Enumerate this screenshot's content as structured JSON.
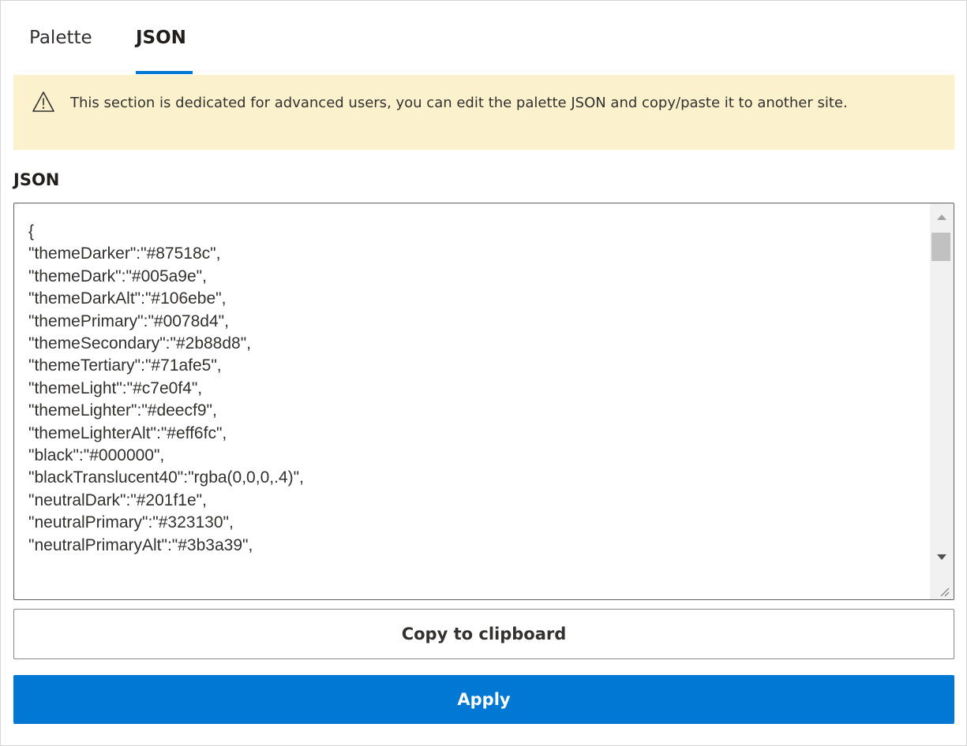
{
  "tabs": {
    "palette_label": "Palette",
    "json_label": "JSON",
    "active": "JSON"
  },
  "warning": {
    "icon": "warning-triangle-icon",
    "text": "This section is dedicated for advanced users, you can edit the palette JSON and copy/paste it to another site."
  },
  "json_field": {
    "label": "JSON",
    "value": "{\n\"themeDarker\":\"#87518c\",\n\"themeDark\":\"#005a9e\",\n\"themeDarkAlt\":\"#106ebe\",\n\"themePrimary\":\"#0078d4\",\n\"themeSecondary\":\"#2b88d8\",\n\"themeTertiary\":\"#71afe5\",\n\"themeLight\":\"#c7e0f4\",\n\"themeLighter\":\"#deecf9\",\n\"themeLighterAlt\":\"#eff6fc\",\n\"black\":\"#000000\",\n\"blackTranslucent40\":\"rgba(0,0,0,.4)\",\n\"neutralDark\":\"#201f1e\",\n\"neutralPrimary\":\"#323130\",\n\"neutralPrimaryAlt\":\"#3b3a39\","
  },
  "buttons": {
    "copy_label": "Copy to clipboard",
    "apply_label": "Apply"
  },
  "colors": {
    "accent": "#0078d4",
    "warning_background": "#fcf1cd",
    "text": "#323130"
  }
}
